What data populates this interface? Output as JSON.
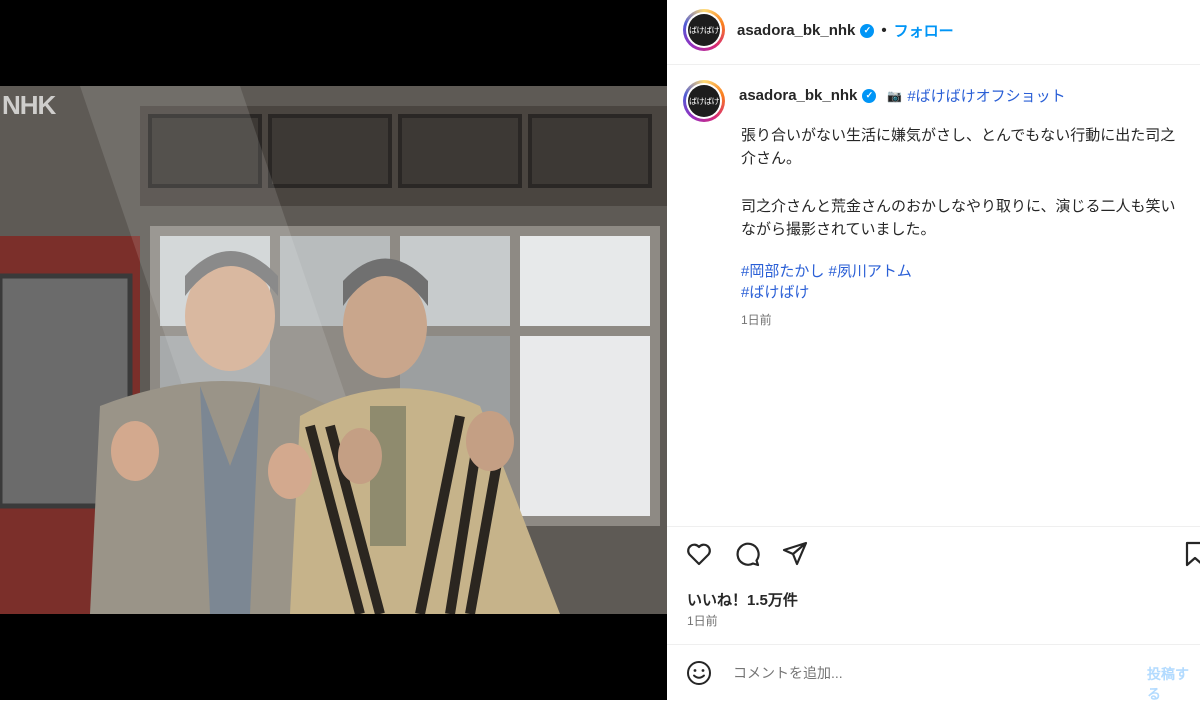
{
  "photo": {
    "watermark": "NHK"
  },
  "header": {
    "avatar_text": "ばけばけ",
    "username": "asadora_bk_nhk",
    "separator": "•",
    "follow_label": "フォロー"
  },
  "caption": {
    "avatar_text": "ばけばけ",
    "username": "asadora_bk_nhk",
    "camera_icon": "📷",
    "hashtag_title": "#ばけばけオフショット",
    "paragraph1": "張り合いがない生活に嫌気がさし、とんでもない行動に出た司之介さん。",
    "paragraph2": "司之介さんと荒金さんのおかしなやり取りに、演じる二人も笑いながら撮影されていました。",
    "tags": [
      "#岡部たかし",
      "#夙川アトム",
      "#ばけばけ"
    ],
    "timestamp": "1日前"
  },
  "actions": {
    "icons": [
      "heart-icon",
      "comment-icon",
      "share-icon",
      "bookmark-icon"
    ]
  },
  "likes": {
    "text": "いいね！1.5万件"
  },
  "post_time": "1日前",
  "comment": {
    "placeholder": "コメントを追加...",
    "post_label": "投稿する"
  },
  "colors": {
    "accent": "#0095f6",
    "hashtag": "#2a5fd6",
    "muted": "#737373"
  }
}
